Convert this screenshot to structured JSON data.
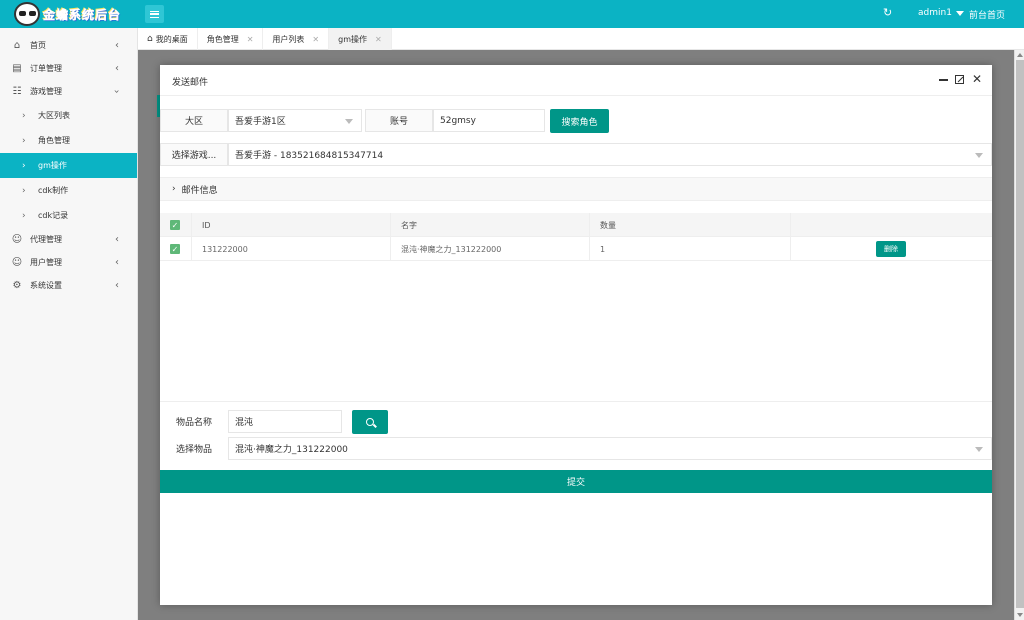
{
  "header": {
    "logo_text": "金蟾系统后台",
    "user": "admin1",
    "front_link": "前台首页"
  },
  "sidebar": {
    "items": [
      {
        "label": "首页",
        "icon": "home-icon"
      },
      {
        "label": "订单管理",
        "icon": "document-icon"
      },
      {
        "label": "游戏管理",
        "icon": "sitemap-icon"
      },
      {
        "label": "大区列表"
      },
      {
        "label": "角色管理"
      },
      {
        "label": "gm操作"
      },
      {
        "label": "cdk制作"
      },
      {
        "label": "cdk记录"
      },
      {
        "label": "代理管理",
        "icon": "agent-icon"
      },
      {
        "label": "用户管理",
        "icon": "user-icon"
      },
      {
        "label": "系统设置",
        "icon": "gear-icon"
      }
    ]
  },
  "tabs": [
    {
      "label": "我的桌面"
    },
    {
      "label": "角色管理"
    },
    {
      "label": "用户列表"
    },
    {
      "label": "gm操作"
    }
  ],
  "modal": {
    "title": "发送邮件",
    "region_label": "大区",
    "region_value": "吾爱手游1区",
    "account_label": "账号",
    "account_value": "52gmsy",
    "search_role_button": "搜索角色",
    "select_game_label": "选择游戏...",
    "select_game_value": "吾爱手游 - 183521684815347714",
    "mail_info_label": "邮件信息",
    "table": {
      "headers": [
        "ID",
        "名字",
        "数量"
      ],
      "rows": [
        {
          "id": "131222000",
          "name": "混沌·神魔之力_131222000",
          "qty": "1",
          "action": "删除"
        }
      ]
    },
    "item_name_label": "物品名称",
    "item_name_value": "混沌",
    "select_item_label": "选择物品",
    "select_item_value": "混沌·神魔之力_131222000",
    "submit_button": "提交"
  },
  "colors": {
    "header": "#0bb3c4",
    "primary_green": "#009688",
    "checkbox_green": "#5fb878"
  }
}
